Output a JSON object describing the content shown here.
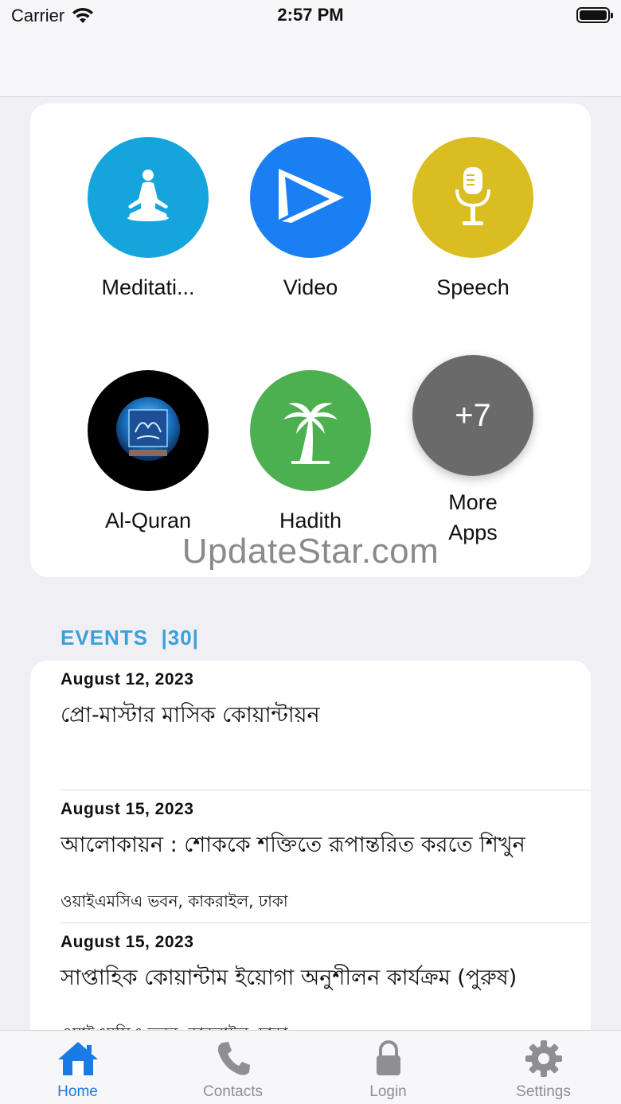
{
  "status_bar": {
    "carrier": "Carrier",
    "time": "2:57 PM"
  },
  "apps": [
    {
      "label": "Meditati...",
      "icon": "meditation-icon",
      "color": "#14a5dd"
    },
    {
      "label": "Video",
      "icon": "play-icon",
      "color": "#1a7ff3"
    },
    {
      "label": "Speech",
      "icon": "microphone-icon",
      "color": "#d9bd21"
    },
    {
      "label": "Al-Quran",
      "icon": "quran-icon",
      "color": "#000000"
    },
    {
      "label": "Hadith",
      "icon": "palm-tree-icon",
      "color": "#4caf50"
    },
    {
      "label": "More\nApps",
      "badge": "+7",
      "icon": "more-apps-icon",
      "color": "#6a6a6a"
    }
  ],
  "watermark": "UpdateStar.com",
  "events": {
    "header": "EVENTS  |30|",
    "items": [
      {
        "date": "August 12, 2023",
        "title": "প্রো-মাস্টার মাসিক কোয়ান্টায়ন",
        "venue": ""
      },
      {
        "date": "August 15, 2023",
        "title": "আলোকায়ন : শোককে শক্তিতে রূপান্তরিত করতে শিখুন",
        "venue": "ওয়াইএমসিএ ভবন, কাকরাইল, ঢাকা"
      },
      {
        "date": "August 15, 2023",
        "title": "সাপ্তাহিক কোয়ান্টাম ইয়োগা অনুশীলন কার্যক্রম (পুরুষ)",
        "venue": "ওয়াইএমসিএ ভবন, কাকরাইল, ঢাকা"
      }
    ]
  },
  "tabs": [
    {
      "label": "Home",
      "icon": "home-icon",
      "active": true
    },
    {
      "label": "Contacts",
      "icon": "phone-icon",
      "active": false
    },
    {
      "label": "Login",
      "icon": "lock-icon",
      "active": false
    },
    {
      "label": "Settings",
      "icon": "gear-icon",
      "active": false
    }
  ],
  "colors": {
    "accent": "#1a7be6",
    "events_header": "#3aa0d8",
    "inactive": "#8e8e93"
  }
}
